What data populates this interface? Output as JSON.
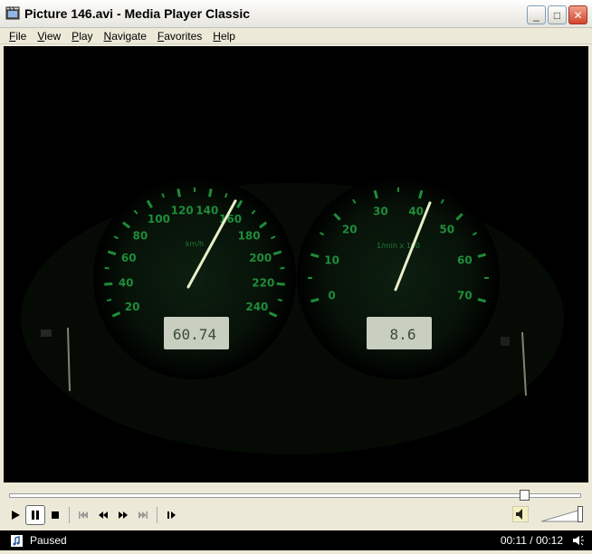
{
  "window": {
    "title": "Picture 146.avi - Media Player Classic",
    "minimize": "_",
    "maximize": "□",
    "close": "✕"
  },
  "menu": [
    {
      "ul": "F",
      "rest": "ile"
    },
    {
      "ul": "V",
      "rest": "iew"
    },
    {
      "ul": "P",
      "rest": "lay"
    },
    {
      "ul": "N",
      "rest": "avigate"
    },
    {
      "ul": "F",
      "rest": "avorites"
    },
    {
      "ul": "H",
      "rest": "elp"
    }
  ],
  "video": {
    "speedo_ticks": [
      "20",
      "40",
      "60",
      "80",
      "100",
      "120",
      "140",
      "160",
      "180",
      "200",
      "220",
      "240"
    ],
    "speedo_unit": "km/h",
    "speedo_lcd": "60.74",
    "tacho_ticks": [
      "0",
      "10",
      "20",
      "30",
      "40",
      "50",
      "60",
      "70"
    ],
    "tacho_unit": "1/min x 100",
    "tacho_lcd": "8.6"
  },
  "playback": {
    "progress": 0.9,
    "status": "Paused",
    "time": "00:11 / 00:12",
    "volume": 1.0
  },
  "colors": {
    "gauge_green": "#1f8c3a",
    "needle": "#e8f0c8",
    "lcd_bg": "#c8cfc0"
  }
}
